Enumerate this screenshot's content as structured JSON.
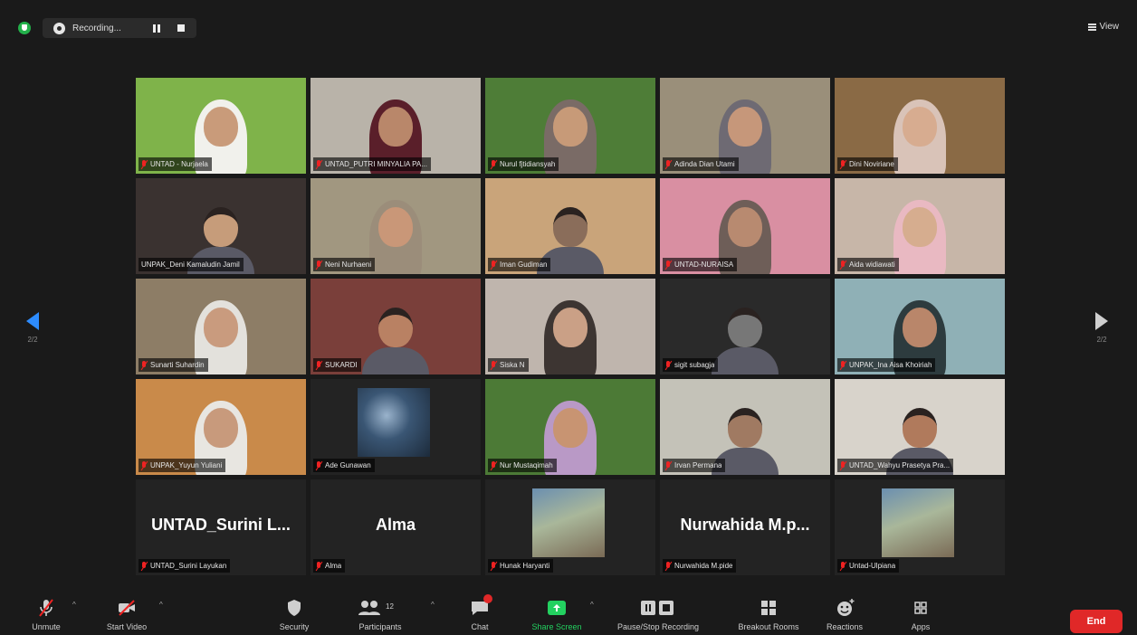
{
  "topbar": {
    "recording_label": "Recording...",
    "view_label": "View"
  },
  "pager": {
    "left_page": "2/2",
    "right_page": "2/2"
  },
  "participants": [
    {
      "name": "UNTAD - Nurjaela",
      "bg": "#7fb34a",
      "skin": "#c99b7a",
      "veil": "#f1f1ec"
    },
    {
      "name": "UNTAD_PUTRI MINYALIA PA...",
      "bg": "#b9b3a9",
      "skin": "#b9876a",
      "veil": "#5a1f2a"
    },
    {
      "name": "Nurul fjtidiansyah",
      "bg": "#4e7d37",
      "skin": "#c79a78",
      "veil": "#7a6b66"
    },
    {
      "name": "Adinda Dian Utami",
      "bg": "#9a8f7a",
      "skin": "#c6977a",
      "veil": "#6e6a73"
    },
    {
      "name": "Dini Noviriane",
      "bg": "#8a6a45",
      "skin": "#d7ac90",
      "veil": "#d9c3b8"
    },
    {
      "name": "UNPAK_Deni Kamaludin Jamil",
      "bg": "#3a3230",
      "skin": "#c69c7a",
      "veil": "",
      "active": true
    },
    {
      "name": "Neni Nurhaeni",
      "bg": "#a19780",
      "skin": "#c99778",
      "veil": "#9b8d7a"
    },
    {
      "name": "Iman Gudiman",
      "bg": "#c9a47a",
      "skin": "#8a6d5a",
      "veil": ""
    },
    {
      "name": "UNTAD-NURAISA",
      "bg": "#d98fa2",
      "skin": "#b88a70",
      "veil": "#6e5e58"
    },
    {
      "name": "Aida widiawati",
      "bg": "#c7b6a8",
      "skin": "#d6ad8f",
      "veil": "#e9b9c2"
    },
    {
      "name": "Sunarti Suhardin",
      "bg": "#8d7d66",
      "skin": "#c99b7e",
      "veil": "#e3e1dc"
    },
    {
      "name": "SUKARDI",
      "bg": "#7a3f3a",
      "skin": "#b98163",
      "veil": ""
    },
    {
      "name": "Siska N",
      "bg": "#bfb5ad",
      "skin": "#caa086",
      "veil": "#3d3532"
    },
    {
      "name": "sigit subagja",
      "bg": "#2a2a2a",
      "skin": "#777",
      "veil": ""
    },
    {
      "name": "UNPAK_Ina Aisa Khoiriah",
      "bg": "#8fb0b6",
      "skin": "#b9866a",
      "veil": "#2d3b3e"
    },
    {
      "name": "UNPAK_Yuyun Yuliani",
      "bg": "#c98a4a",
      "skin": "#c89a7c",
      "veil": "#e8e6e1"
    },
    {
      "name": "Ade Gunawan",
      "bg": "#232323",
      "skin": "",
      "veil": ""
    },
    {
      "name": "Nur Mustaqimah",
      "bg": "#4c7a36",
      "skin": "#c89472",
      "veil": "#b999c6"
    },
    {
      "name": "Irvan Permana",
      "bg": "#c4c2b8",
      "skin": "#a07a62",
      "veil": ""
    },
    {
      "name": "UNTAD_Wahyu Prasetya Pra...",
      "bg": "#d8d3cb",
      "skin": "#b07a5c",
      "veil": ""
    },
    {
      "name": "UNTAD_Surini Layukan",
      "display": "UNTAD_Surini L...",
      "bg": "#232323"
    },
    {
      "name": "Alma",
      "display": "Alma",
      "bg": "#232323"
    },
    {
      "name": "Hunak Haryanti",
      "bg": "#232323",
      "avatar": true
    },
    {
      "name": "Nurwahida M.pide",
      "display": "Nurwahida M.p...",
      "bg": "#232323"
    },
    {
      "name": "Untad-Ulpiana",
      "bg": "#232323",
      "avatar": true
    }
  ],
  "toolbar": {
    "unmute": "Unmute",
    "start_video": "Start Video",
    "security": "Security",
    "participants": "Participants",
    "participants_count": "12",
    "chat": "Chat",
    "share_screen": "Share Screen",
    "record": "Pause/Stop Recording",
    "breakout": "Breakout Rooms",
    "reactions": "Reactions",
    "apps": "Apps",
    "end": "End"
  }
}
